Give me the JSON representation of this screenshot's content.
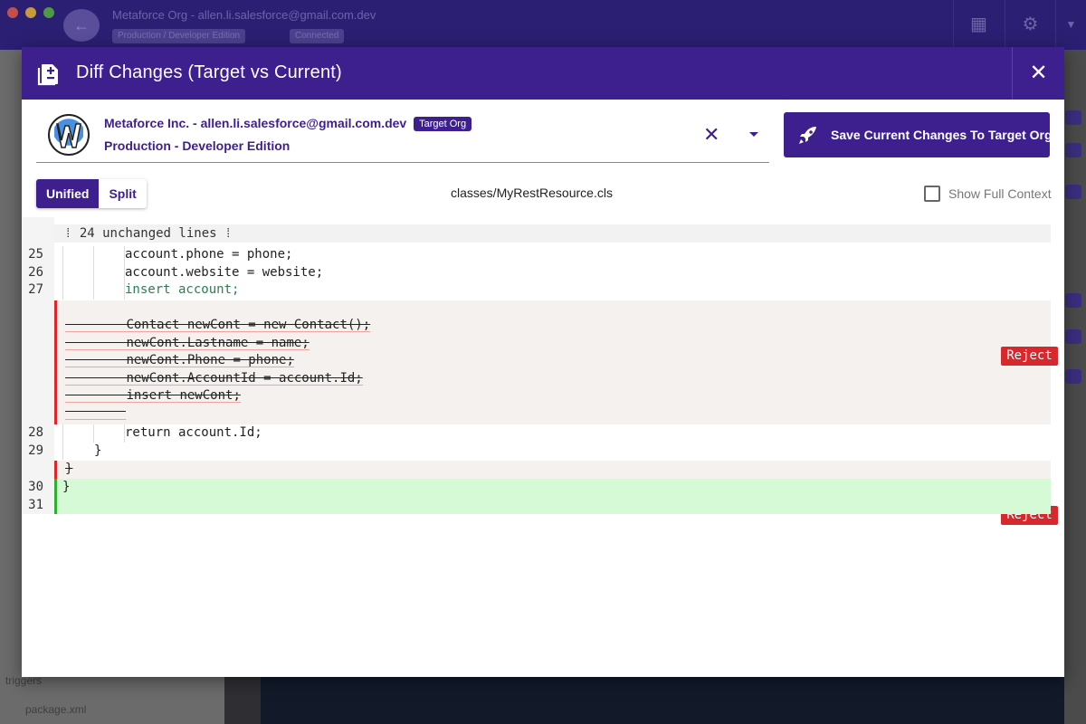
{
  "background": {
    "window_title": "Metaforce Org - allen.li.salesforce@gmail.com.dev",
    "badges": [
      "Production / Developer Edition",
      "Connected"
    ],
    "sidebar_items": [
      "triggers",
      "package.xml"
    ]
  },
  "modal": {
    "title": "Diff Changes (Target vs Current)",
    "org": {
      "name": "Metaforce Inc. - allen.li.salesforce@gmail.com.dev",
      "tag": "Target Org",
      "edition": "Production - Developer Edition"
    },
    "save_button": "Save Current Changes To Target Org",
    "view_toggle": {
      "unified": "Unified",
      "split": "Split",
      "active": "Unified"
    },
    "file_name": "classes/MyRestResource.cls",
    "full_context_label": "Show Full Context",
    "full_context_checked": false,
    "reject_label": "Reject"
  },
  "diff": {
    "unchanged_text": "⁞ 24 unchanged lines ⁞",
    "context_before": [
      {
        "ln": "25",
        "code": "account.phone = phone;"
      },
      {
        "ln": "26",
        "code": "account.website = website;"
      },
      {
        "ln": "27",
        "code": "insert account;"
      }
    ],
    "removed_block_1": [
      "Contact newCont = new Contact();",
      "newCont.Lastname = name;",
      "newCont.Phone = phone;",
      "newCont.AccountId = account.Id;",
      "insert newCont;",
      ""
    ],
    "context_after": [
      {
        "ln": "28",
        "code": "return account.Id;"
      },
      {
        "ln": "29",
        "code": "}"
      }
    ],
    "removed_block_2": [
      "}"
    ],
    "added_block": [
      {
        "ln": "30",
        "code": "}"
      },
      {
        "ln": "31",
        "code": ""
      }
    ]
  },
  "colors": {
    "brand": "#3d1f8e",
    "reject": "#d7282e",
    "removed_bg": "#f5f1ef",
    "added_bg": "#d5fad5"
  }
}
